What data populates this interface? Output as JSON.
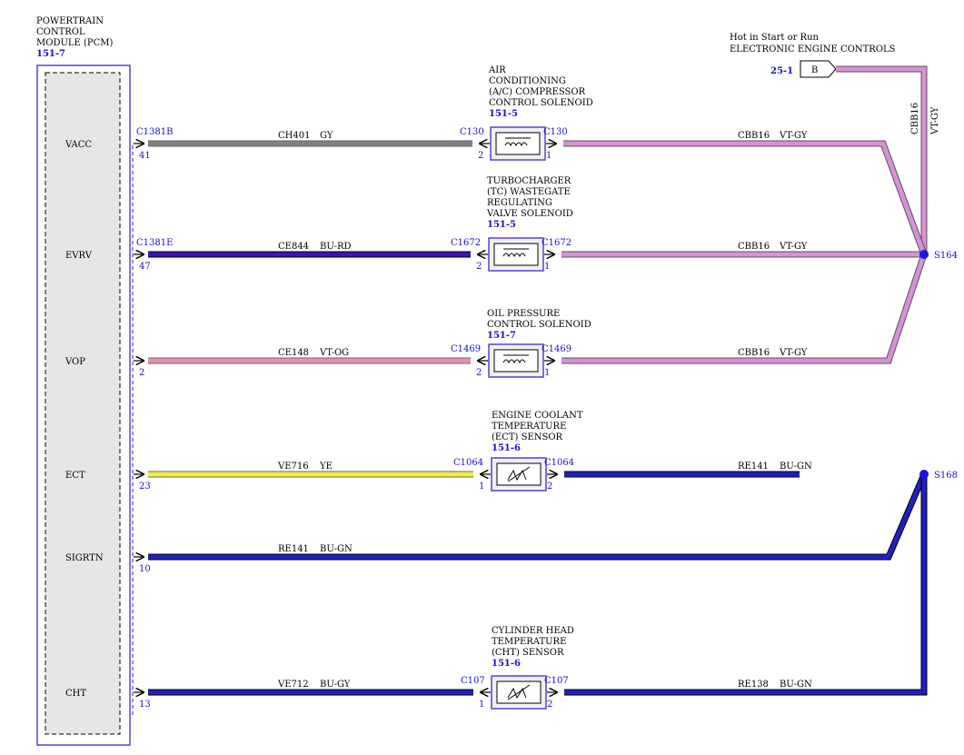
{
  "module": {
    "title_lines": [
      "POWERTRAIN",
      "CONTROL",
      "MODULE (PCM)"
    ],
    "ref": "151-7"
  },
  "power": {
    "caption_lines": [
      "Hot in Start or Run",
      "ELECTRONIC ENGINE CONTROLS"
    ],
    "ref": "25-1",
    "connector": "B",
    "vertical_wire": {
      "circuit": "CBB16",
      "color": "VT-GY"
    }
  },
  "splices": {
    "top": "S164",
    "bottom": "S168"
  },
  "circuits": [
    {
      "pin_name": "VACC",
      "pcm_connector": "C1381B",
      "pcm_pin": "41",
      "in_circuit": "CH401",
      "in_color": "GY",
      "component_lines": [
        "AIR",
        "CONDITIONING",
        "(A/C) COMPRESSOR",
        "CONTROL SOLENOID"
      ],
      "component_ref": "151-5",
      "comp_left_connector": "C130",
      "comp_left_pin": "2",
      "comp_right_connector": "C130",
      "comp_right_pin": "1",
      "out_circuit": "CBB16",
      "out_color": "VT-GY",
      "type": "solenoid"
    },
    {
      "pin_name": "EVRV",
      "pcm_connector": "C1381E",
      "pcm_pin": "47",
      "in_circuit": "CE844",
      "in_color": "BU-RD",
      "component_lines": [
        "TURBOCHARGER",
        "(TC) WASTEGATE",
        "REGULATING",
        "VALVE SOLENOID"
      ],
      "component_ref": "151-5",
      "comp_left_connector": "C1672",
      "comp_left_pin": "2",
      "comp_right_connector": "C1672",
      "comp_right_pin": "1",
      "out_circuit": "CBB16",
      "out_color": "VT-GY",
      "type": "solenoid"
    },
    {
      "pin_name": "VOP",
      "pcm_connector": "",
      "pcm_pin": "2",
      "in_circuit": "CE148",
      "in_color": "VT-OG",
      "component_lines": [
        "OIL PRESSURE",
        "CONTROL SOLENOID"
      ],
      "component_ref": "151-7",
      "comp_left_connector": "C1469",
      "comp_left_pin": "2",
      "comp_right_connector": "C1469",
      "comp_right_pin": "1",
      "out_circuit": "CBB16",
      "out_color": "VT-GY",
      "type": "solenoid"
    },
    {
      "pin_name": "ECT",
      "pcm_connector": "",
      "pcm_pin": "23",
      "in_circuit": "VE716",
      "in_color": "YE",
      "component_lines": [
        "ENGINE COOLANT",
        "TEMPERATURE",
        "(ECT) SENSOR"
      ],
      "component_ref": "151-6",
      "comp_left_connector": "C1064",
      "comp_left_pin": "1",
      "comp_right_connector": "C1064",
      "comp_right_pin": "2",
      "out_circuit": "RE141",
      "out_color": "BU-GN",
      "type": "sensor"
    },
    {
      "pin_name": "SIGRTN",
      "pcm_connector": "",
      "pcm_pin": "10",
      "in_circuit": "RE141",
      "in_color": "BU-GN"
    },
    {
      "pin_name": "CHT",
      "pcm_connector": "",
      "pcm_pin": "13",
      "in_circuit": "VE712",
      "in_color": "BU-GY",
      "component_lines": [
        "CYLINDER HEAD",
        "TEMPERATURE",
        "(CHT) SENSOR"
      ],
      "component_ref": "151-6",
      "comp_left_connector": "C107",
      "comp_left_pin": "1",
      "comp_right_connector": "C107",
      "comp_right_pin": "2",
      "out_circuit": "RE138",
      "out_color": "BU-GN",
      "type": "sensor"
    }
  ],
  "wire_colors": {
    "GY": "#808080",
    "VT-GY": "#d890d8",
    "BU-RD": "#4010c0",
    "VT-OG": "#e890b8",
    "YE": "#f0f040",
    "BU-GN": "#2020c0",
    "BU-GY": "#2020c0"
  }
}
